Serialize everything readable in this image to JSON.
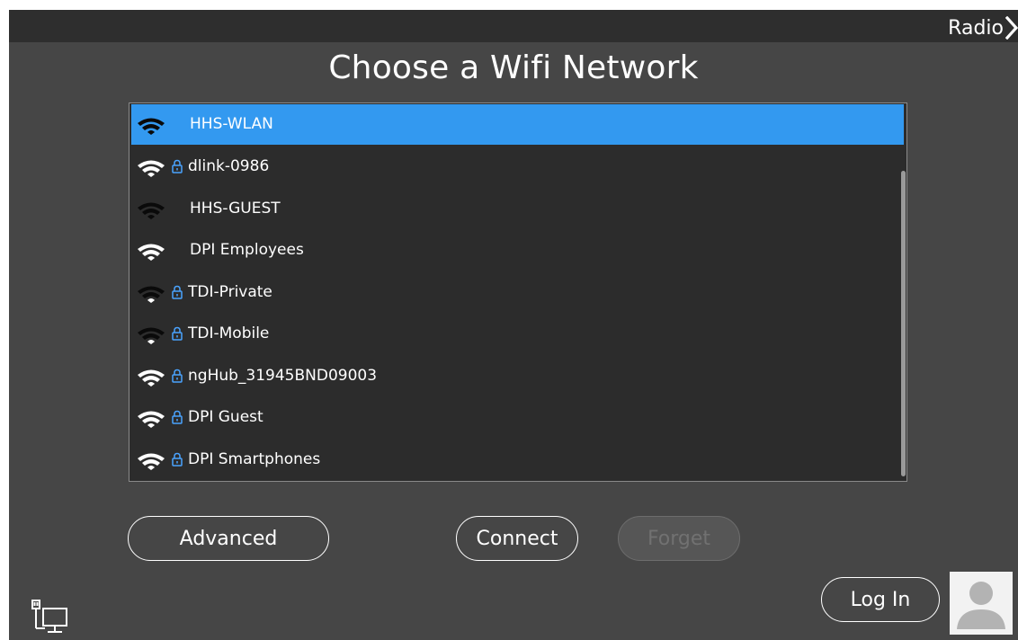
{
  "header": {
    "radio_label": "Radio",
    "radio_icon": "chevron-right-icon"
  },
  "title": "Choose a Wifi Network",
  "networks": [
    {
      "name": "HHS-WLAN",
      "secured": false,
      "signal": "dark",
      "selected": true
    },
    {
      "name": "dlink-0986",
      "secured": true,
      "signal": "light",
      "selected": false
    },
    {
      "name": "HHS-GUEST",
      "secured": false,
      "signal": "dark",
      "selected": false
    },
    {
      "name": "DPI Employees",
      "secured": false,
      "signal": "light",
      "selected": false
    },
    {
      "name": "TDI-Private",
      "secured": true,
      "signal": "dark",
      "selected": false
    },
    {
      "name": "TDI-Mobile",
      "secured": true,
      "signal": "dark",
      "selected": false
    },
    {
      "name": "ngHub_31945BND09003",
      "secured": true,
      "signal": "light",
      "selected": false
    },
    {
      "name": "DPI Guest",
      "secured": true,
      "signal": "light",
      "selected": false
    },
    {
      "name": "DPI Smartphones",
      "secured": true,
      "signal": "light",
      "selected": false
    }
  ],
  "buttons": {
    "advanced": "Advanced",
    "connect": "Connect",
    "forget": "Forget",
    "login": "Log In"
  },
  "icons": {
    "wifi": "wifi-icon",
    "lock": "lock-icon",
    "ethernet": "ethernet-icon",
    "avatar": "user-avatar-icon"
  },
  "colors": {
    "background": "#464646",
    "topbar": "#2e2e2e",
    "list_background": "#2c2c2c",
    "selection": "#3399f0",
    "lock": "#4aa3ff",
    "signal_dark": "#0a0a0a",
    "signal_light": "#ffffff"
  }
}
